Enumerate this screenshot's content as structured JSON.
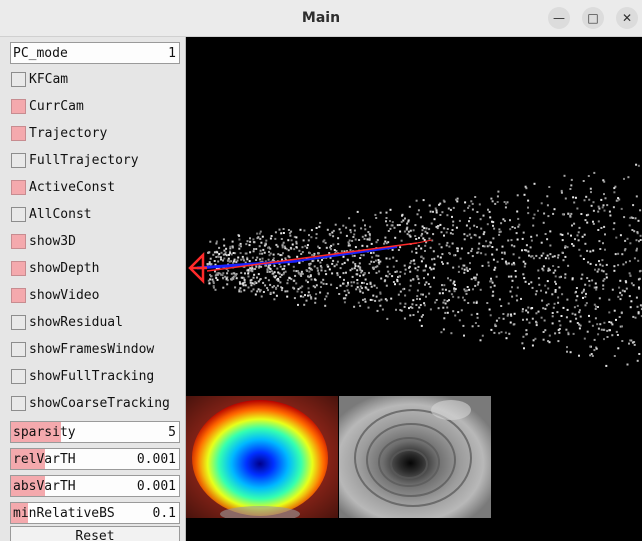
{
  "window": {
    "title": "Main",
    "minimize_glyph": "—",
    "maximize_glyph": "□",
    "close_glyph": "✕"
  },
  "panel": {
    "pc_mode": {
      "label": "PC_mode",
      "value": "1"
    },
    "checkboxes": [
      {
        "label": "KFCam",
        "checked": false
      },
      {
        "label": "CurrCam",
        "checked": true
      },
      {
        "label": "Trajectory",
        "checked": true
      },
      {
        "label": "FullTrajectory",
        "checked": false
      },
      {
        "label": "ActiveConst",
        "checked": true
      },
      {
        "label": "AllConst",
        "checked": false
      },
      {
        "label": "show3D",
        "checked": true
      },
      {
        "label": "showDepth",
        "checked": true
      },
      {
        "label": "showVideo",
        "checked": true
      },
      {
        "label": "showResidual",
        "checked": false
      },
      {
        "label": "showFramesWindow",
        "checked": false
      },
      {
        "label": "showFullTracking",
        "checked": false
      },
      {
        "label": "showCoarseTracking",
        "checked": false
      }
    ],
    "sliders": [
      {
        "label": "sparsity",
        "value": "5",
        "level": 0.3
      },
      {
        "label": "relVarTH",
        "value": "0.001",
        "level": 0.2
      },
      {
        "label": "absVarTH",
        "value": "0.001",
        "level": 0.2
      },
      {
        "label": "minRelativeBS",
        "value": "0.1",
        "level": 0.1
      }
    ],
    "reset_label": "Reset"
  },
  "colors": {
    "accent": "#f4a9ad",
    "trajectory_blue": "#1a22ff",
    "trajectory_red": "#ff2a2a"
  }
}
